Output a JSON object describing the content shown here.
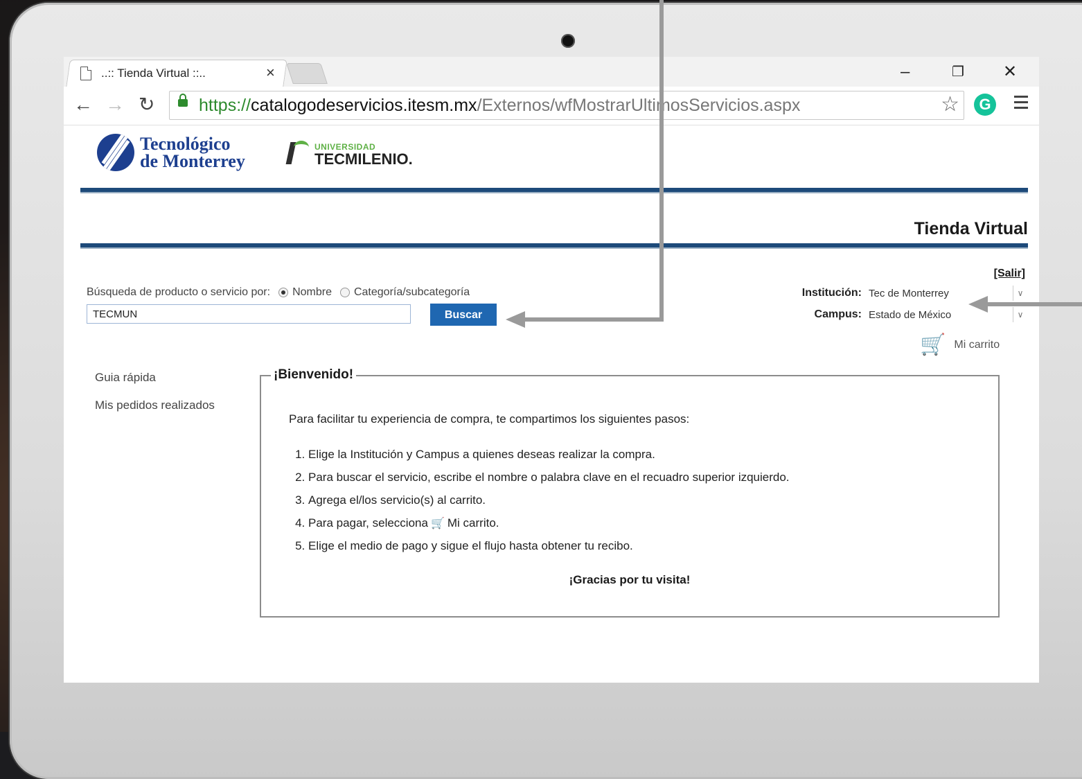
{
  "browser": {
    "tab_title": "..:: Tienda Virtual ::..",
    "tab_close": "×",
    "win_min": "–",
    "win_restore": "❐",
    "win_close": "✕",
    "url_scheme": "https://",
    "url_host": "catalogodeservicios.itesm.mx",
    "url_path": "/Externos/wfMostrarUltimosServicios.aspx",
    "ext_letter": "G"
  },
  "logos": {
    "tec_line1": "Tecnológico",
    "tec_line2": "de Monterrey",
    "tml_small": "UNIVERSIDAD",
    "tml_big": "TECMILENIO."
  },
  "header": {
    "store_title": "Tienda Virtual",
    "salir": "[Salir]"
  },
  "search": {
    "label": "Búsqueda de producto o servicio por:",
    "option_name": "Nombre",
    "option_category": "Categoría/subcategoría",
    "selected": "Nombre",
    "value": "TECMUN",
    "button": "Buscar"
  },
  "selectors": {
    "institution_label": "Institución:",
    "institution_value": "Tec de Monterrey",
    "campus_label": "Campus:",
    "campus_value": "Estado de México"
  },
  "cart": {
    "label": "Mi carrito"
  },
  "sidebar": {
    "items": [
      {
        "label": "Guia rápida"
      },
      {
        "label": "Mis pedidos realizados"
      }
    ]
  },
  "welcome": {
    "title": "¡Bienvenido!",
    "intro": "Para facilitar tu experiencia de compra, te compartimos los siguientes pasos:",
    "steps": [
      "Elige la Institución y Campus a quienes deseas realizar la compra.",
      "Para buscar el servicio, escribe el nombre o palabra clave en el recuadro superior izquierdo.",
      "Agrega el/los servicio(s) al carrito.",
      "Para pagar, selecciona",
      "Elige el medio de pago y sigue el flujo hasta obtener tu recibo."
    ],
    "step4_suffix": "Mi carrito.",
    "thanks": "¡Gracias por tu visita!"
  },
  "colors": {
    "accent": "#1f67b1",
    "rule": "#1d4a7a",
    "secure": "#2d8a2d"
  }
}
